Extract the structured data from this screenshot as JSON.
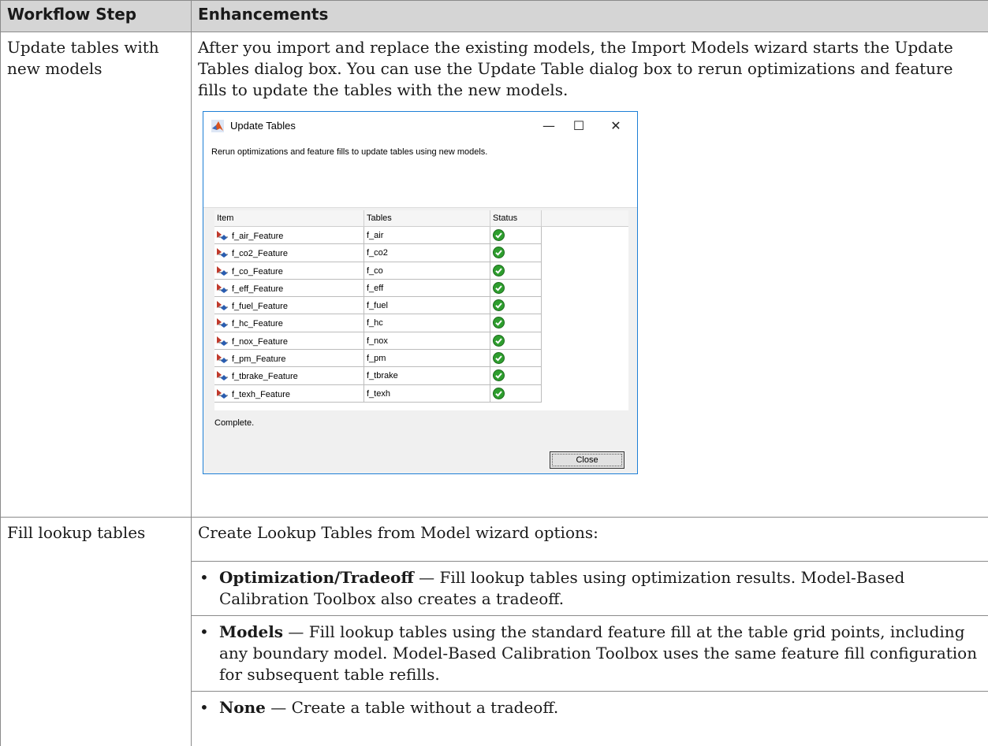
{
  "table": {
    "headers": {
      "step": "Workflow Step",
      "enhancements": "Enhancements"
    },
    "row1": {
      "step": "Update tables with new models",
      "text": "After you import and replace the existing models, the Import Models wizard starts the Update Tables dialog box. You can use the Update Table dialog box to rerun optimizations and feature fills to update the tables with the new models."
    },
    "row2": {
      "step": "Fill lookup tables",
      "intro": "Create Lookup Tables from Model wizard options:",
      "bullet": "•",
      "options": [
        {
          "term": "Optimization/Tradeoff",
          "desc": " — Fill lookup tables using optimization results. Model-Based Calibration Toolbox also creates a tradeoff."
        },
        {
          "term": "Models",
          "desc": " — Fill lookup tables using the standard feature fill at the table grid points, including any boundary model. Model-Based Calibration Toolbox uses the same feature fill configuration for subsequent table refills."
        },
        {
          "term": "None",
          "desc": " — Create a table without a tradeoff."
        }
      ]
    }
  },
  "dialog": {
    "title": "Update Tables",
    "min_glyph": "—",
    "max_glyph": "☐",
    "close_glyph": "✕",
    "message": "Rerun optimizations and feature fills to update tables using new models.",
    "columns": {
      "item": "Item",
      "tables": "Tables",
      "status": "Status"
    },
    "rows": [
      {
        "item": "f_air_Feature",
        "table": "f_air",
        "status_icon": "check-circle-icon"
      },
      {
        "item": "f_co2_Feature",
        "table": "f_co2",
        "status_icon": "check-circle-icon"
      },
      {
        "item": "f_co_Feature",
        "table": "f_co",
        "status_icon": "check-circle-icon"
      },
      {
        "item": "f_eff_Feature",
        "table": "f_eff",
        "status_icon": "check-circle-icon"
      },
      {
        "item": "f_fuel_Feature",
        "table": "f_fuel",
        "status_icon": "check-circle-icon"
      },
      {
        "item": "f_hc_Feature",
        "table": "f_hc",
        "status_icon": "check-circle-icon"
      },
      {
        "item": "f_nox_Feature",
        "table": "f_nox",
        "status_icon": "check-circle-icon"
      },
      {
        "item": "f_pm_Feature",
        "table": "f_pm",
        "status_icon": "check-circle-icon"
      },
      {
        "item": "f_tbrake_Feature",
        "table": "f_tbrake",
        "status_icon": "check-circle-icon"
      },
      {
        "item": "f_texh_Feature",
        "table": "f_texh",
        "status_icon": "check-circle-icon"
      }
    ],
    "status_text": "Complete.",
    "close_label": "Close"
  },
  "colors": {
    "header_bg": "#d5d5d5",
    "accent_border": "#1e7fd6",
    "status_ok": "#2e9e2e"
  }
}
